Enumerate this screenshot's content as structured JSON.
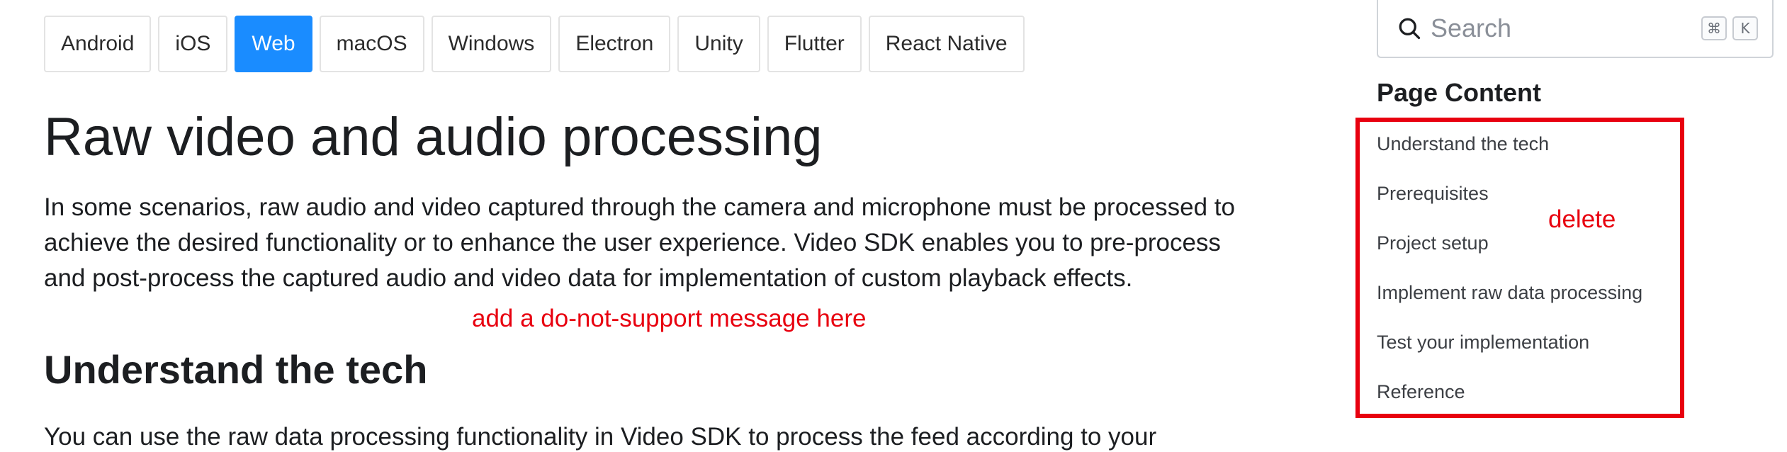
{
  "platform_tabs": [
    {
      "label": "Android",
      "active": false
    },
    {
      "label": "iOS",
      "active": false
    },
    {
      "label": "Web",
      "active": true
    },
    {
      "label": "macOS",
      "active": false
    },
    {
      "label": "Windows",
      "active": false
    },
    {
      "label": "Electron",
      "active": false
    },
    {
      "label": "Unity",
      "active": false
    },
    {
      "label": "Flutter",
      "active": false
    },
    {
      "label": "React Native",
      "active": false
    }
  ],
  "main": {
    "title": "Raw video and audio processing",
    "intro_lines": [
      "In some scenarios, raw audio and video captured through the camera and microphone must be processed to",
      "achieve the desired functionality or to enhance the user experience. Video SDK enables you to pre-process",
      "and post-process the captured audio and video data for implementation of custom playback effects."
    ],
    "section_title": "Understand the tech",
    "section_text": "You can use the raw data processing functionality in Video SDK to process the feed according to your"
  },
  "annotations": {
    "add_message": "add a do-not-support message here",
    "delete": "delete",
    "color": "#e8000f"
  },
  "search": {
    "placeholder": "Search",
    "shortcut_keys": [
      "⌘",
      "K"
    ]
  },
  "toc": {
    "heading": "Page Content",
    "items": [
      "Understand the tech",
      "Prerequisites",
      "Project setup",
      "Implement raw data processing",
      "Test your implementation",
      "Reference"
    ]
  },
  "colors": {
    "accent": "#1a8cff",
    "text": "#1c1e21"
  }
}
